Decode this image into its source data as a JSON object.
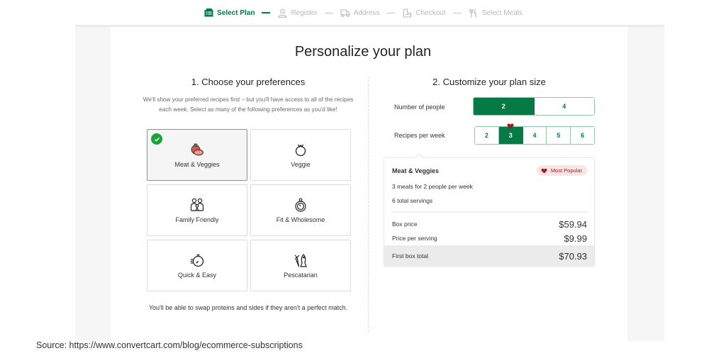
{
  "stepper": {
    "steps": [
      {
        "label": "Select Plan",
        "icon": "menu-card-icon",
        "active": true
      },
      {
        "label": "Register",
        "icon": "user-icon",
        "active": false
      },
      {
        "label": "Address",
        "icon": "truck-icon",
        "active": false
      },
      {
        "label": "Checkout",
        "icon": "checkout-icon",
        "active": false
      },
      {
        "label": "Select Meals",
        "icon": "fork-knife-icon",
        "active": false
      }
    ]
  },
  "page": {
    "title": "Personalize your plan"
  },
  "preferences": {
    "heading": "1. Choose your preferences",
    "intro": "We'll show your preferred recipes first – but you'll have access to all of the recipes each week. Select as many of the following preferences as you'd like!",
    "options": [
      {
        "label": "Meat & Veggies",
        "icon": "meat-veggies-icon",
        "selected": true
      },
      {
        "label": "Veggie",
        "icon": "tomato-icon",
        "selected": false
      },
      {
        "label": "Family Friendly",
        "icon": "family-icon",
        "selected": false
      },
      {
        "label": "Fit & Wholesome",
        "icon": "apple-scale-icon",
        "selected": false
      },
      {
        "label": "Quick & Easy",
        "icon": "stopwatch-icon",
        "selected": false
      },
      {
        "label": "Pescatarian",
        "icon": "fish-carrot-icon",
        "selected": false
      }
    ],
    "footnote": "You'll be able to swap proteins and sides if they aren't a perfect match."
  },
  "plan_size": {
    "heading": "2. Customize your plan size",
    "people": {
      "label": "Number of people",
      "options": [
        "2",
        "4"
      ],
      "selected": "2"
    },
    "recipes": {
      "label": "Recipes per week",
      "options": [
        "2",
        "3",
        "4",
        "5",
        "6"
      ],
      "selected": "3",
      "popular": "3"
    }
  },
  "summary": {
    "plan_name": "Meat & Veggies",
    "badge": "Most Popular",
    "meals_line": "3 meals for 2 people per week",
    "servings_line": "6 total servings",
    "rows": [
      {
        "label": "Box price",
        "value": "$59.94"
      },
      {
        "label": "Price per serving",
        "value": "$9.99"
      },
      {
        "label": "First box total",
        "value": "$70.93"
      }
    ]
  },
  "colors": {
    "brand_green": "#067a46",
    "check_green": "#1aa33a",
    "heart_red": "#9b1c1c",
    "badge_bg": "#fbe4e4"
  },
  "source": "Source: https://www.convertcart.com/blog/ecommerce-subscriptions"
}
